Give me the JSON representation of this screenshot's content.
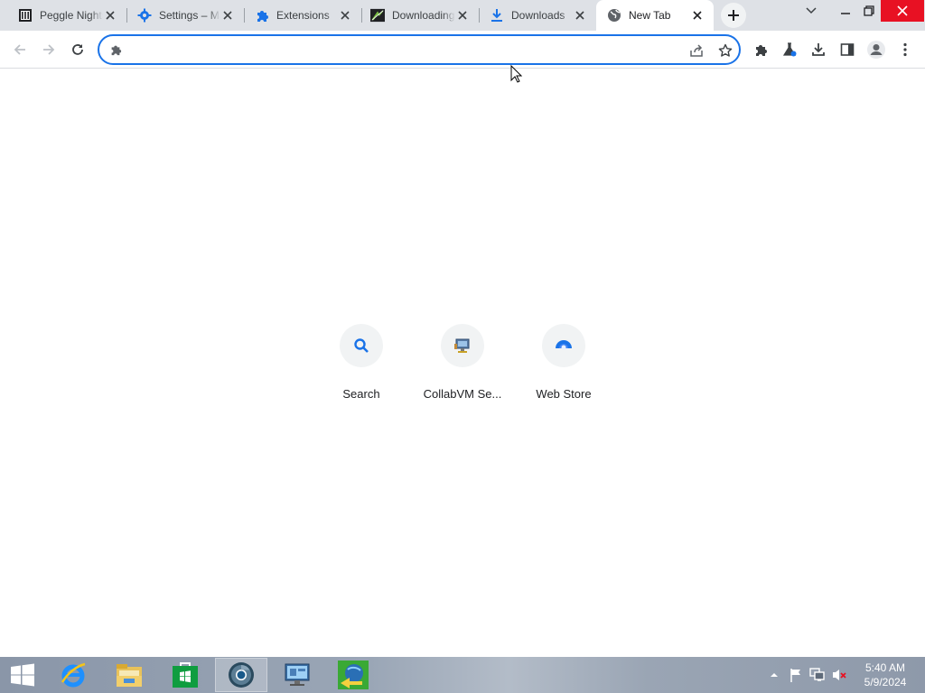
{
  "browser": {
    "tabs": [
      {
        "title": "Peggle Nights",
        "icon": "museum-icon"
      },
      {
        "title": "Settings – Manage",
        "icon": "gear-icon"
      },
      {
        "title": "Extensions",
        "icon": "puzzle-icon"
      },
      {
        "title": "Downloading",
        "icon": "download-site-icon"
      },
      {
        "title": "Downloads",
        "icon": "download-icon"
      },
      {
        "title": "New Tab",
        "icon": "globe-icon",
        "active": true
      }
    ],
    "omnibox": {
      "value": "",
      "placeholder": ""
    },
    "accent_color": "#1a73e8"
  },
  "shortcuts": [
    {
      "label": "Search",
      "icon": "search-icon"
    },
    {
      "label": "CollabVM Se...",
      "icon": "collabvm-icon"
    },
    {
      "label": "Web Store",
      "icon": "webstore-icon"
    }
  ],
  "taskbar": {
    "apps": [
      "start-icon",
      "internet-explorer-icon",
      "file-explorer-icon",
      "store-icon",
      "chrome-icon",
      "remote-desktop-icon",
      "download-manager-icon"
    ],
    "clock": {
      "time": "5:40 AM",
      "date": "5/9/2024"
    }
  }
}
